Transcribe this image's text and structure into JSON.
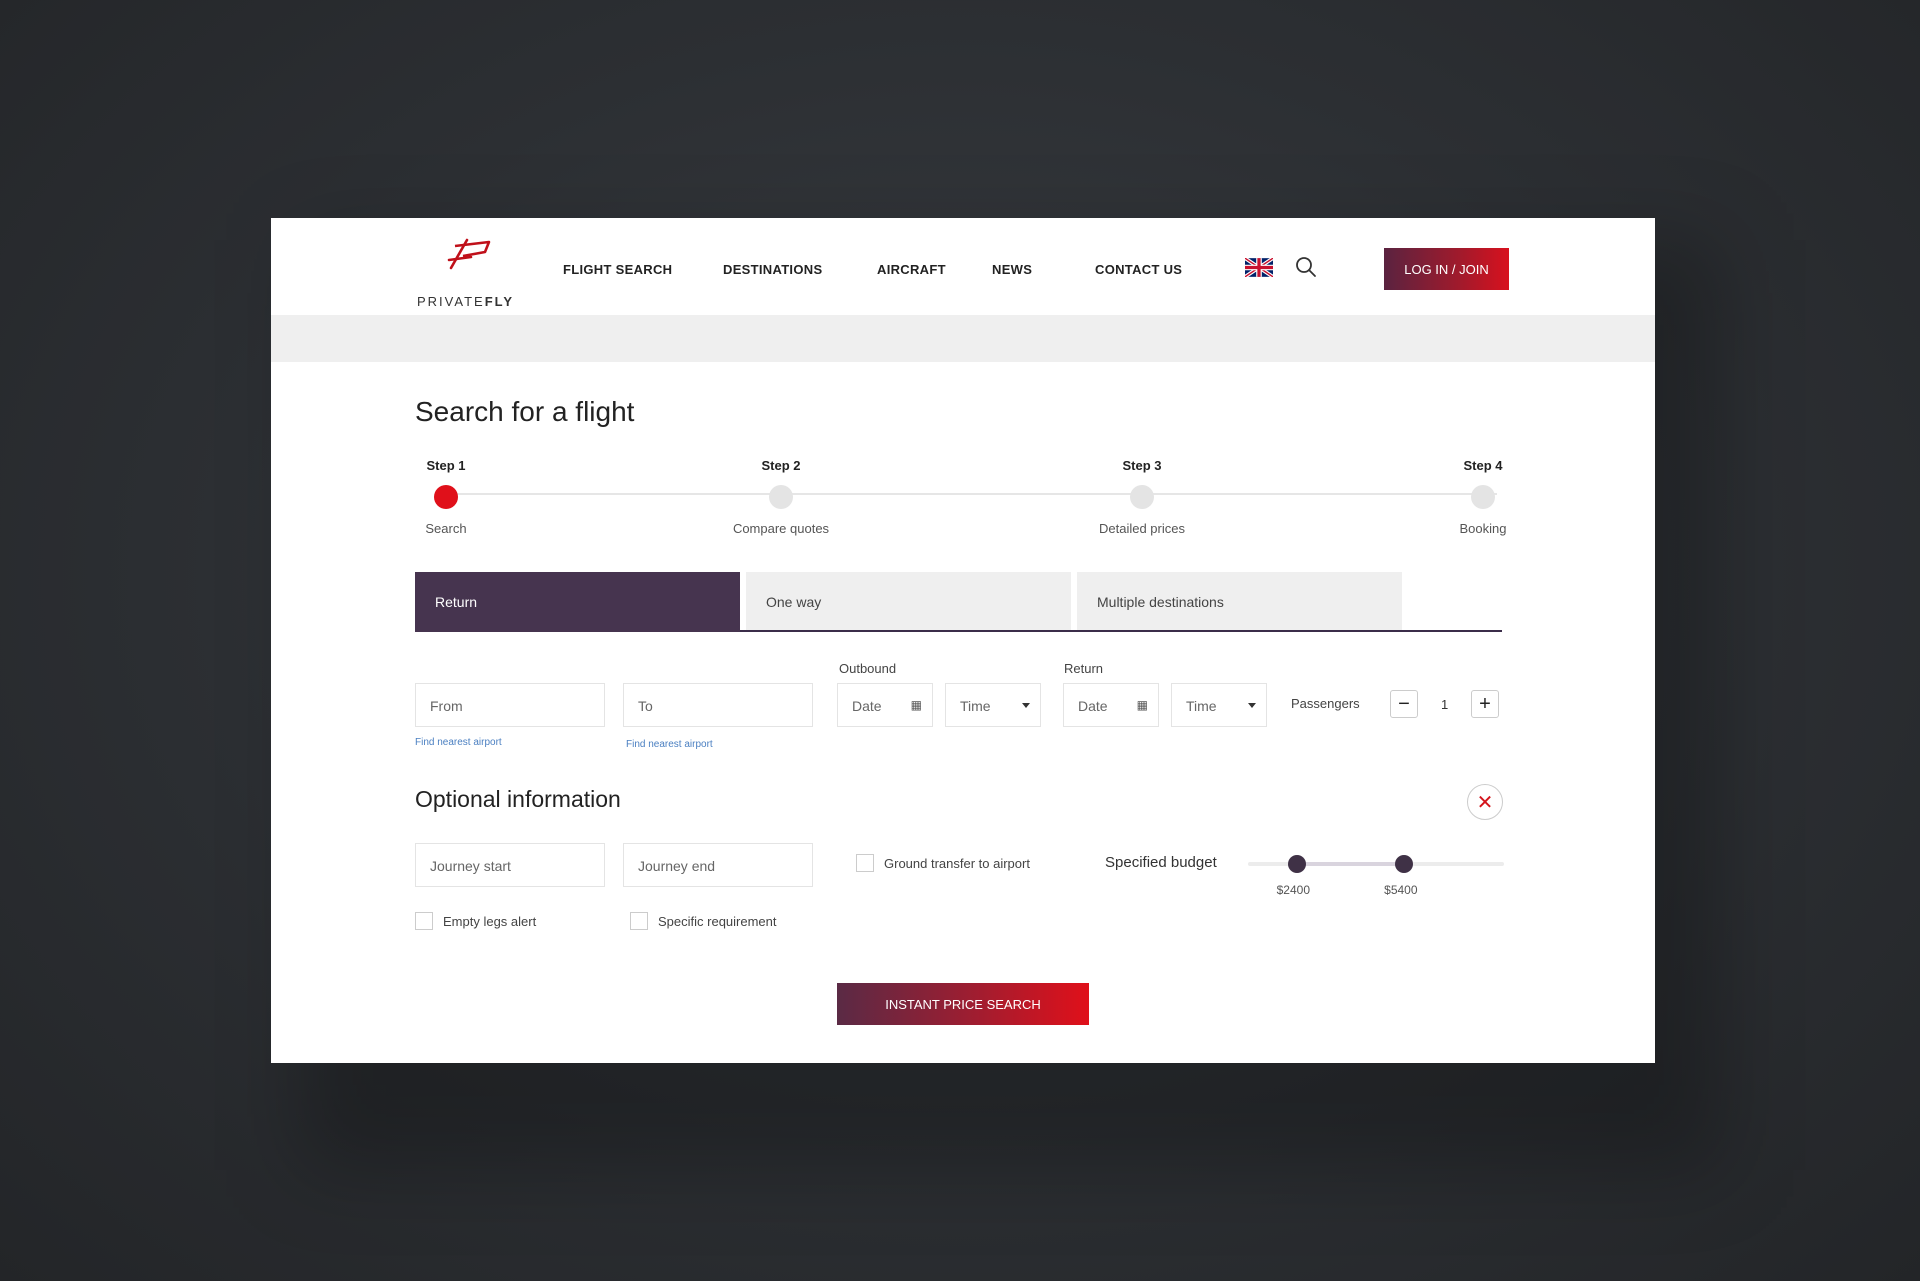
{
  "brand": {
    "logo_prefix": "PRIVATE",
    "logo_bold": "FLY"
  },
  "nav": {
    "items": [
      "FLIGHT SEARCH",
      "DESTINATIONS",
      "AIRCRAFT",
      "NEWS",
      "CONTACT US"
    ],
    "login_label": "LOG IN / JOIN"
  },
  "page_title": "Search for a flight",
  "steps": [
    {
      "label": "Step 1",
      "desc": "Search",
      "active": true
    },
    {
      "label": "Step 2",
      "desc": "Compare quotes",
      "active": false
    },
    {
      "label": "Step 3",
      "desc": "Detailed prices",
      "active": false
    },
    {
      "label": "Step 4",
      "desc": "Booking",
      "active": false
    }
  ],
  "trip_tabs": [
    "Return",
    "One way",
    "Multiple destinations"
  ],
  "form": {
    "from_placeholder": "From",
    "to_placeholder": "To",
    "nearest_airport": "Find nearest airport",
    "outbound_label": "Outbound",
    "return_label": "Return",
    "date_placeholder": "Date",
    "time_placeholder": "Time",
    "passengers_label": "Passengers",
    "passengers_value": "1"
  },
  "optional": {
    "title": "Optional information",
    "journey_start": "Journey start",
    "journey_end": "Journey end",
    "ground_transfer": "Ground transfer to airport",
    "empty_legs": "Empty legs alert",
    "specific_req": "Specific requirement",
    "budget_label": "Specified budget",
    "budget_min": "$2400",
    "budget_max": "$5400",
    "budget_min_fraction": 0.19,
    "budget_max_fraction": 0.61
  },
  "cta": "INSTANT PRICE SEARCH",
  "colors": {
    "accent": "#e0101a",
    "tab_active": "#46344f",
    "link": "#4a7fc1"
  }
}
